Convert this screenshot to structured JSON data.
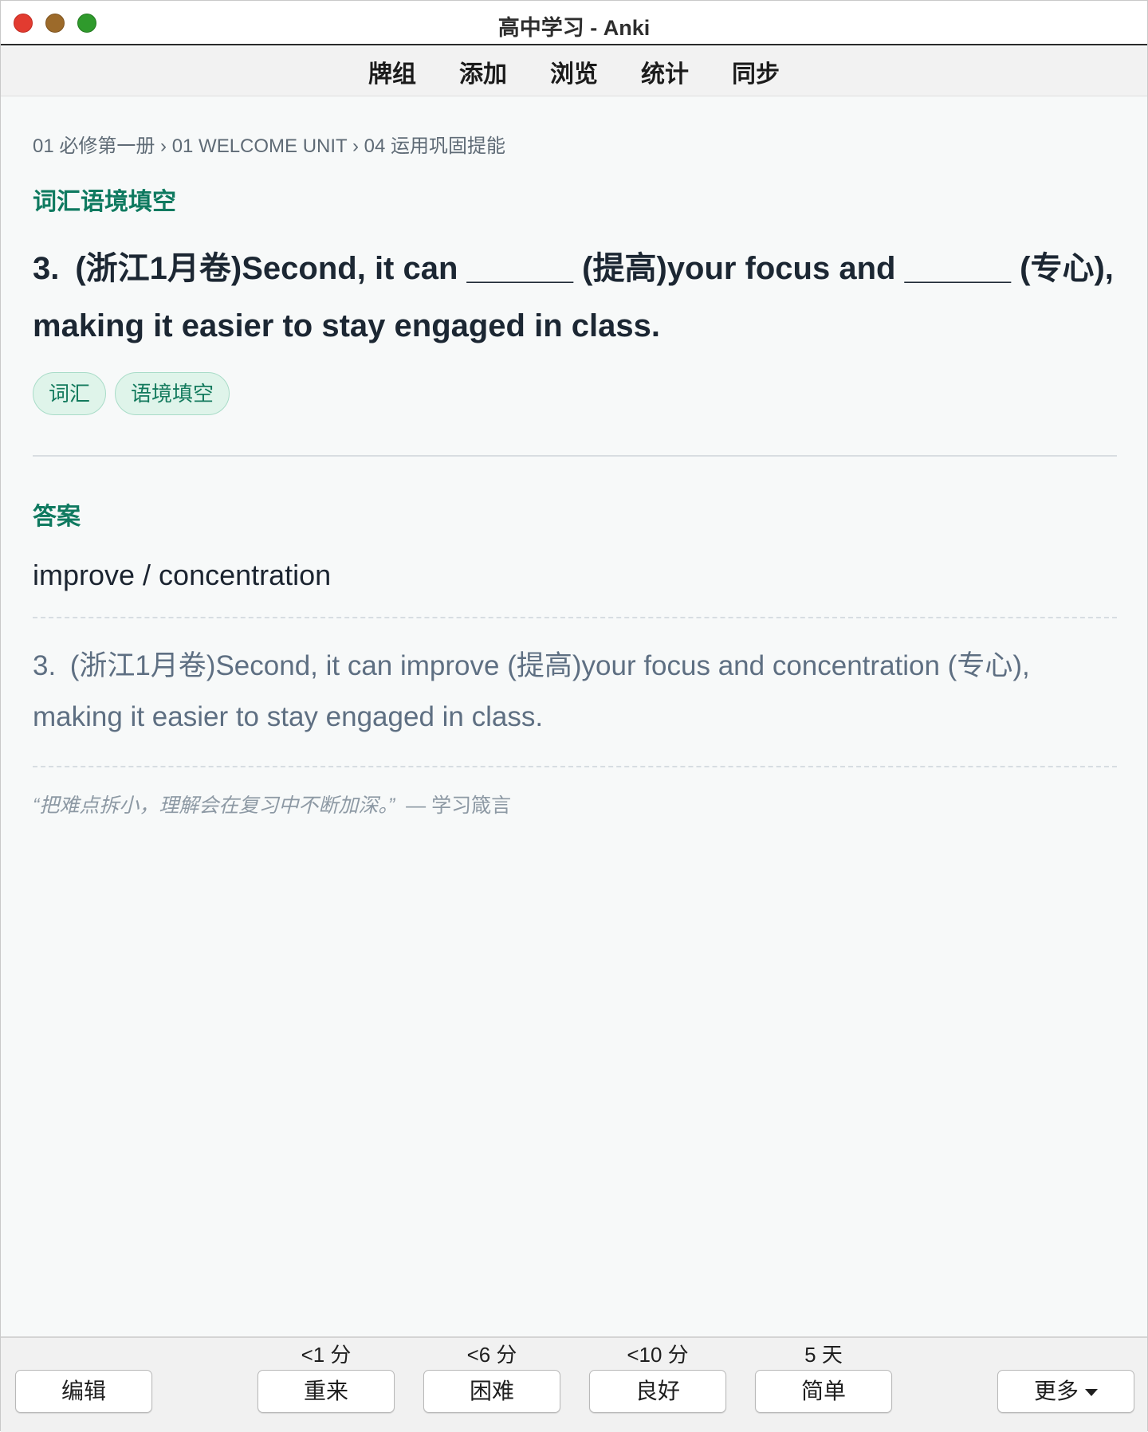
{
  "window": {
    "title": "高中学习 - Anki"
  },
  "toolbar": {
    "items": [
      "牌组",
      "添加",
      "浏览",
      "统计",
      "同步"
    ]
  },
  "card": {
    "breadcrumb": "01 必修第一册 › 01 WELCOME UNIT › 04 运用巩固提能",
    "type_label": "词汇语境填空",
    "question": "3. (浙江1月卷)Second, it can ______ (提高)your focus and ______ (专心), making it easier to stay engaged in class.",
    "tags": [
      "词汇",
      "语境填空"
    ],
    "answer_label": "答案",
    "answer": "improve / concentration",
    "full_sentence": "3. (浙江1月卷)Second, it can improve (提高)your focus and concentration (专心), making it easier to stay engaged in class.",
    "quote": "“把难点拆小，理解会在复习中不断加深。”",
    "quote_source": "— 学习箴言"
  },
  "answer_bar": {
    "edit_label": "编辑",
    "more_label": "更多",
    "buttons": [
      {
        "label": "重来",
        "interval": "<1 分"
      },
      {
        "label": "困难",
        "interval": "<6 分"
      },
      {
        "label": "良好",
        "interval": "<10 分"
      },
      {
        "label": "简单",
        "interval": "5 天"
      }
    ]
  },
  "colors": {
    "accent_green": "#0f7a60",
    "tag_bg": "#dff4ea",
    "close": "#e23b30",
    "minimize": "#9c6a2a",
    "maximize": "#2f9a2c"
  }
}
